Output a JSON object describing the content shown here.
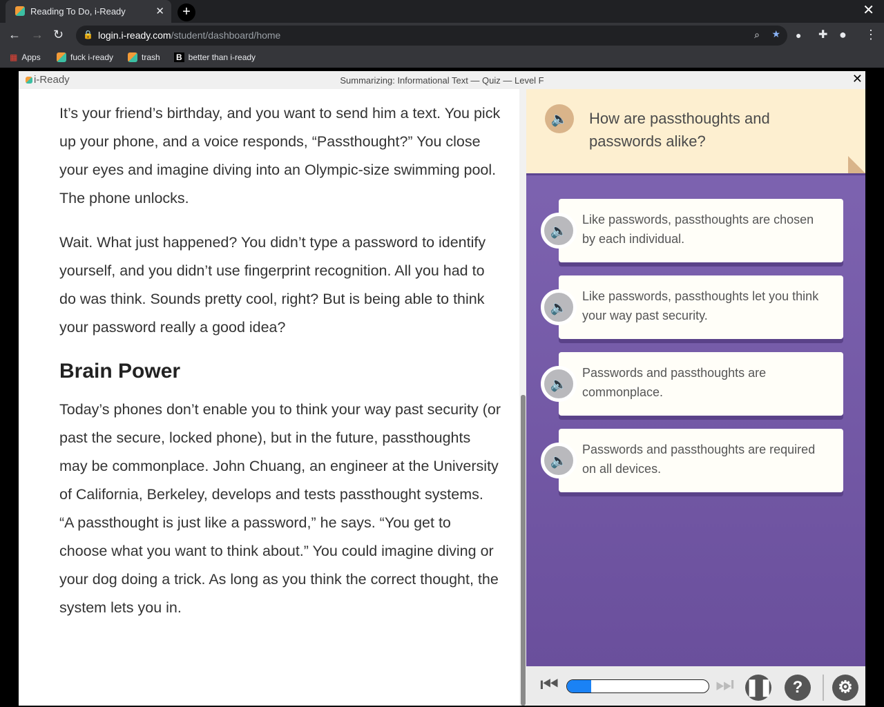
{
  "browser": {
    "tab_title": "Reading To Do, i-Ready",
    "url_host": "login.i-ready.com",
    "url_path": "/student/dashboard/home",
    "bookmarks": [
      "Apps",
      "fuck i-ready",
      "trash",
      "better than i-ready"
    ]
  },
  "app": {
    "logo": "i-Ready",
    "title": "Summarizing: Informational Text — Quiz — Level F"
  },
  "passage": {
    "paragraphs": [
      "It’s your friend’s birthday, and you want to send him a text. You pick up your phone, and a voice responds, “Passthought?” You close your eyes and imagine diving into an Olympic-size swimming pool. The phone unlocks.",
      "Wait. What just happened? You didn’t type a password to identify yourself, and you didn’t use fingerprint recognition. All you had to do was think. Sounds pretty cool, right? But is being able to think your password really a good idea?",
      "Today’s phones don’t enable you to think your way past security (or past the secure, locked phone), but in the future, passthoughts may be commonplace. John Chuang, an engineer at the University of California, Berkeley, develops and tests passthought systems. “A passthought is just like a password,” he says. “You get to choose what you want to think about.” You could imagine diving or your dog doing a trick. As long as you think the correct thought, the system lets you in."
    ],
    "heading": "Brain Power"
  },
  "question": {
    "text": "How are passthoughts and passwords alike?",
    "answers": [
      "Like passwords, passthoughts are chosen by each individual.",
      "Like passwords, passthoughts let you think your way past security.",
      "Passwords and passthoughts are commonplace.",
      "Passwords and passthoughts are required on all devices."
    ]
  },
  "toolbar": {
    "progress_percent": 17,
    "progress_color": "#1a82f5"
  }
}
